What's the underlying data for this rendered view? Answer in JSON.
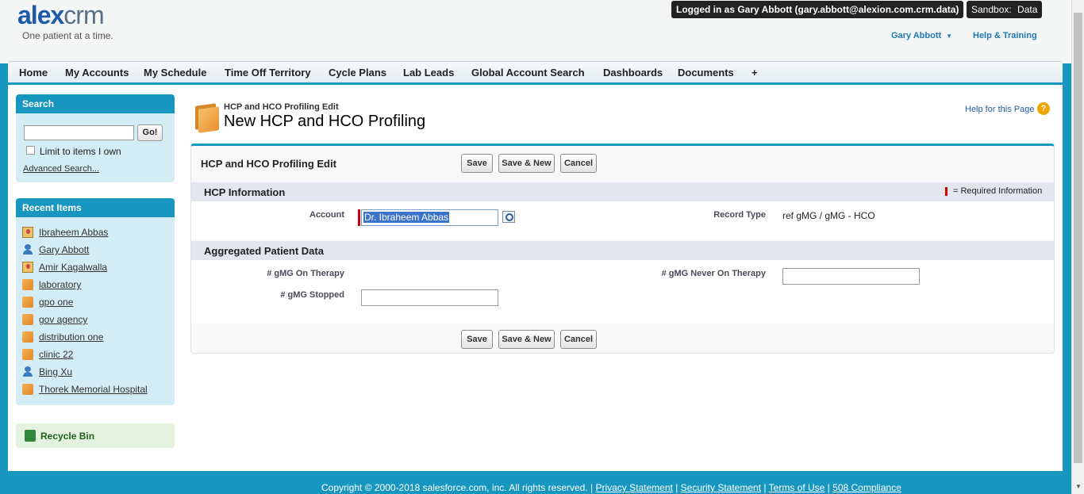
{
  "brand": {
    "logo_alex": "alex",
    "logo_crm": "crm",
    "tagline": "One patient at a time."
  },
  "header": {
    "login_text": "Logged in as Gary Abbott (gary.abbott@alexion.com.crm.data)",
    "sandbox_text": "Sandbox:  Data",
    "user_name": "Gary Abbott",
    "help_training": "Help & Training"
  },
  "nav": {
    "tabs": [
      "Home",
      "My Accounts",
      "My Schedule",
      "Time Off Territory",
      "Cycle Plans",
      "Lab Leads",
      "Global Account Search",
      "Dashboards",
      "Documents",
      "+"
    ]
  },
  "sidebar": {
    "search_title": "Search",
    "go_label": "Go!",
    "limit_label": "Limit to items I own",
    "advanced_search": "Advanced Search...",
    "recent_title": "Recent Items",
    "recent_items": [
      {
        "label": "Ibraheem Abbas",
        "icon": "contact-card-icon"
      },
      {
        "label": "Gary Abbott",
        "icon": "user-icon"
      },
      {
        "label": "Amir Kagalwalla",
        "icon": "contact-card-icon"
      },
      {
        "label": "laboratory",
        "icon": "account-folder-icon"
      },
      {
        "label": "gpo one",
        "icon": "account-folder-icon"
      },
      {
        "label": "gov agency",
        "icon": "account-folder-icon"
      },
      {
        "label": "distribution one",
        "icon": "account-folder-icon"
      },
      {
        "label": "clinic 22",
        "icon": "account-folder-icon"
      },
      {
        "label": "Bing Xu",
        "icon": "user-icon"
      },
      {
        "label": "Thorek Memorial Hospital",
        "icon": "account-folder-icon"
      }
    ],
    "recycle_bin": "Recycle Bin"
  },
  "page": {
    "subtitle": "HCP and HCO Profiling Edit",
    "title": "New HCP and HCO Profiling",
    "help_link": "Help for this Page",
    "help_icon": "?"
  },
  "form": {
    "title": "HCP and HCO Profiling Edit",
    "save": "Save",
    "save_new": "Save & New",
    "cancel": "Cancel",
    "required_info": "= Required Information",
    "section_hcp": "HCP Information",
    "account_label": "Account",
    "account_value": "Dr. Ibraheem Abbas",
    "record_type_label": "Record Type",
    "record_type_value": "ref gMG / gMG - HCO",
    "section_patient": "Aggregated Patient Data",
    "on_therapy_label": "# gMG On Therapy",
    "never_on_therapy_label": "# gMG Never On Therapy",
    "stopped_label": "# gMG Stopped",
    "on_therapy_value": "",
    "never_on_therapy_value": "",
    "stopped_value": ""
  },
  "footer": {
    "copyright": "Copyright © 2000-2018 salesforce.com, inc. All rights reserved. |",
    "privacy": "Privacy Statement",
    "security": "Security Statement",
    "terms": "Terms of Use",
    "compliance": "508 Compliance",
    "sep": "|"
  },
  "colors": {
    "brand_blue": "#1797c0",
    "logo_blue": "#1c5aa8",
    "required_red": "#cc0000"
  }
}
